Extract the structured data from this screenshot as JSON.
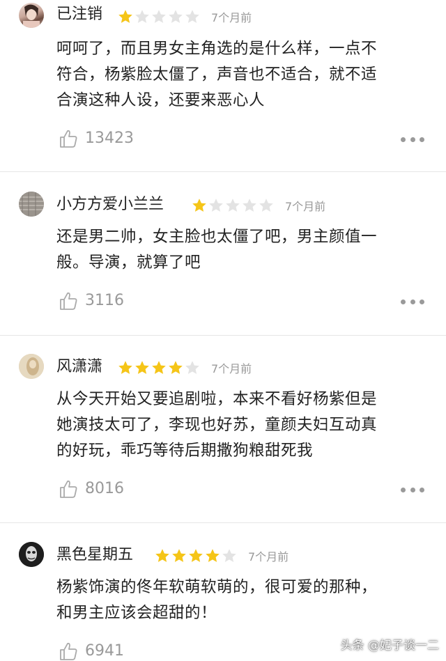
{
  "colors": {
    "star_on": "#f5c518",
    "star_off": "#e3e3e3",
    "muted": "#999999",
    "text": "#222222"
  },
  "reviews": [
    {
      "user": "已注销",
      "rating": 1,
      "max_rating": 5,
      "time": "7个月前",
      "lines": [
        "呵呵了，而且男女主角选的是什么样，一点不",
        "符合，杨紫脸太僵了，声音也不适合，就不适",
        "合演这种人设，还要来恶心人"
      ],
      "likes": "13423"
    },
    {
      "user": "小方方爱小兰兰",
      "rating": 1,
      "max_rating": 5,
      "time": "7个月前",
      "lines": [
        "还是男二帅，女主脸也太僵了吧，男主颜值一",
        "般。导演，就算了吧"
      ],
      "likes": "3116"
    },
    {
      "user": "风潇潇",
      "rating": 4,
      "max_rating": 5,
      "time": "7个月前",
      "lines": [
        "从今天开始又要追剧啦，本来不看好杨紫但是",
        "她演技太可了，李现也好苏，童颜夫妇互动真",
        "的好玩，乖巧等待后期撒狗粮甜死我"
      ],
      "likes": "8016"
    },
    {
      "user": "黑色星期五",
      "rating": 4,
      "max_rating": 5,
      "time": "7个月前",
      "lines": [
        "杨紫饰演的佟年软萌软萌的，很可爱的那种，",
        "和男主应该会超甜的！"
      ],
      "likes": "6941"
    }
  ],
  "watermark": "头条 @妃子谈一二"
}
